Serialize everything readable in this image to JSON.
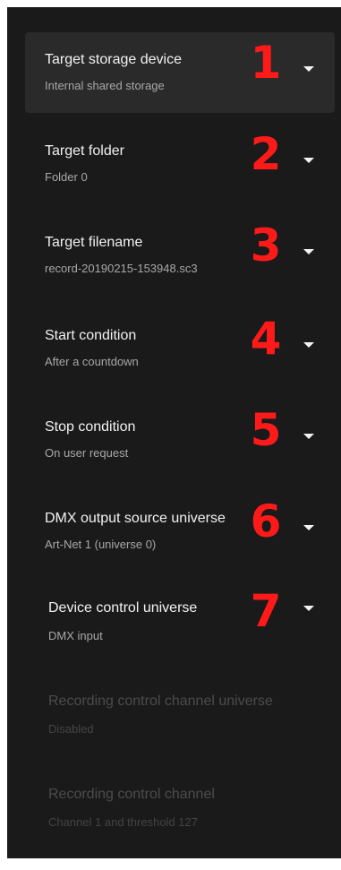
{
  "settings": {
    "items": [
      {
        "title": "Target storage device",
        "subtitle": "Internal shared storage",
        "number": "1",
        "icon": "chevron-down-icon"
      },
      {
        "title": "Target folder",
        "subtitle": "Folder 0",
        "number": "2",
        "icon": "chevron-down-icon"
      },
      {
        "title": "Target filename",
        "subtitle": "record-20190215-153948.sc3",
        "number": "3",
        "icon": "chevron-down-icon"
      },
      {
        "title": "Start condition",
        "subtitle": "After a countdown",
        "number": "4",
        "icon": "chevron-down-icon"
      },
      {
        "title": "Stop condition",
        "subtitle": "On user request",
        "number": "5",
        "icon": "chevron-down-icon"
      },
      {
        "title": "DMX output source universe",
        "subtitle": "Art-Net 1 (universe 0)",
        "number": "6",
        "icon": "chevron-down-icon"
      },
      {
        "title": "Device control universe",
        "subtitle": "DMX input",
        "number": "7",
        "icon": "chevron-down-icon"
      }
    ],
    "disabled_items": [
      {
        "title": "Recording control channel universe",
        "subtitle": "Disabled"
      },
      {
        "title": "Recording control channel",
        "subtitle": "Channel 1 and threshold 127"
      }
    ]
  },
  "colors": {
    "panel_background": "#1a1a1a",
    "selected_background": "#2a2a2a",
    "annotation_number": "#ff1a1a",
    "title_text": "#f2f2f2",
    "subtitle_text": "#a8a8a8",
    "disabled_text": "#4c4c4c"
  }
}
